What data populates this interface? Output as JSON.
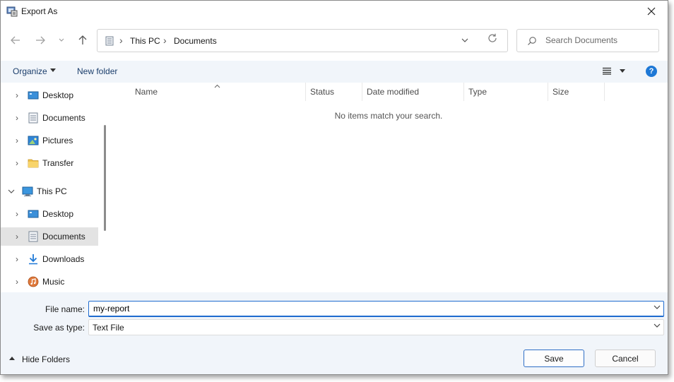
{
  "window": {
    "title": "Export As"
  },
  "address": {
    "crumbs": [
      "This PC",
      "Documents"
    ]
  },
  "search": {
    "placeholder": "Search Documents"
  },
  "toolbar": {
    "organize": "Organize",
    "new_folder": "New folder"
  },
  "sidebar": {
    "items": [
      {
        "label": "Desktop",
        "icon": "desktop-icon"
      },
      {
        "label": "Documents",
        "icon": "documents-icon"
      },
      {
        "label": "Pictures",
        "icon": "pictures-icon"
      },
      {
        "label": "Transfer",
        "icon": "folder-icon"
      },
      {
        "label": "This PC",
        "icon": "computer-icon"
      },
      {
        "label": "Desktop",
        "icon": "desktop-icon"
      },
      {
        "label": "Documents",
        "icon": "documents-icon",
        "selected": true
      },
      {
        "label": "Downloads",
        "icon": "downloads-icon"
      },
      {
        "label": "Music",
        "icon": "music-icon"
      }
    ]
  },
  "filelist": {
    "columns": [
      "Name",
      "Status",
      "Date modified",
      "Type",
      "Size"
    ],
    "empty_message": "No items match your search."
  },
  "form": {
    "filename_label": "File name:",
    "filename_value": "my-report",
    "type_label": "Save as type:",
    "type_value": "Text File"
  },
  "footer": {
    "hide_folders": "Hide Folders",
    "save": "Save",
    "cancel": "Cancel"
  },
  "colors": {
    "accent": "#1e6bcf",
    "commandbar": "#f1f5fa",
    "selection": "#e3e3e3"
  }
}
